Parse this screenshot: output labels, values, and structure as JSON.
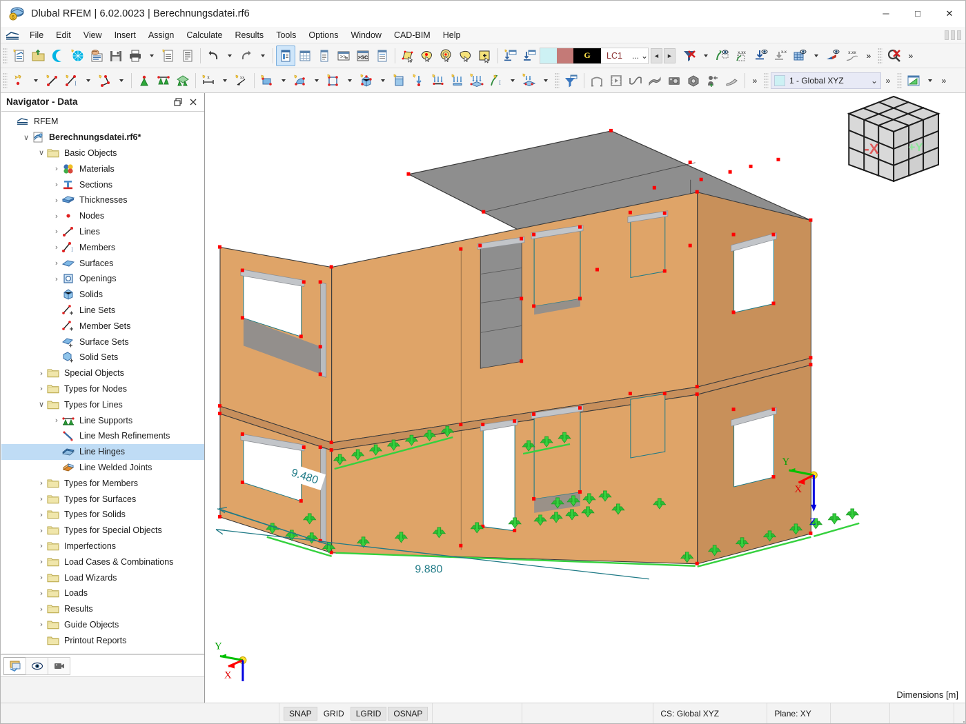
{
  "window": {
    "title": "Dlubal RFEM | 6.02.0023 | Berechnungsdatei.rf6",
    "app_icon": "rfem-app-icon",
    "minimize": "─",
    "maximize": "□",
    "close": "✕"
  },
  "menu": {
    "logo": "rfem-logo-icon",
    "items": [
      {
        "label": "File"
      },
      {
        "label": "Edit"
      },
      {
        "label": "View"
      },
      {
        "label": "Insert"
      },
      {
        "label": "Assign"
      },
      {
        "label": "Calculate"
      },
      {
        "label": "Results"
      },
      {
        "label": "Tools"
      },
      {
        "label": "Options"
      },
      {
        "label": "Window"
      },
      {
        "label": "CAD-BIM"
      },
      {
        "label": "Help"
      }
    ]
  },
  "toolbar_row1": {
    "groups": [
      {
        "icons": [
          "new-model-icon",
          "open-folder-icon",
          "dlubal-center-icon",
          "dlubal-sphere-icon",
          "model-info-icon",
          "save-icon",
          "print-icon",
          "print-caret",
          "new-report-icon",
          "report-icon"
        ]
      },
      {
        "icons": [
          "undo-icon",
          "undo-caret",
          "redo-icon",
          "redo-caret"
        ]
      },
      {
        "icons": [
          "navigator-panel-icon",
          "table-panel-icon",
          "list-panel-icon",
          "console-icon",
          "script-icon",
          "properties-panel-icon"
        ]
      },
      {
        "icons": [
          "select-polygon-icon",
          "select-lasso-icon",
          "select-circle-icon",
          "select-freehand-icon",
          "select-box-plus-icon"
        ]
      },
      {
        "icons": [
          "new-load-case-icon",
          "import-load-case-icon"
        ]
      }
    ],
    "load_case": {
      "swatch_cyan": "#cdf1f4",
      "swatch_red": "#c47a77",
      "g_label": "G",
      "lc_label": "LC1",
      "dots": "...",
      "prev": "◄",
      "next": "►"
    },
    "groups_right": [
      {
        "icons": [
          "filter-clear-icon",
          "filter-caret",
          "render-visibility-icon",
          "value-visibility-icon",
          "deformation-icon",
          "support-display-icon",
          "grid-display-icon",
          "grid-caret",
          "diagram-display-icon",
          "curve-value-icon"
        ]
      },
      {
        "icons": [
          "zoom-clear-icon"
        ]
      }
    ],
    "overflow": "»"
  },
  "toolbar_row2": {
    "groups": [
      {
        "icons": [
          "new-node-icon",
          "node-caret",
          "new-line-icon",
          "new-member-icon",
          "member-caret",
          "new-polyline-icon",
          "polyline-caret"
        ]
      },
      {
        "icons": [
          "nodal-support-icon",
          "line-support-icon",
          "surface-support-icon"
        ]
      },
      {
        "icons": [
          "dimension-x-icon",
          "dimension-caret",
          "dimension-xx-icon"
        ]
      },
      {
        "icons": [
          "new-surface-icon",
          "surface-caret",
          "new-curved-surface-icon",
          "curved-caret",
          "new-opening-icon",
          "opening-caret",
          "new-solid-icon",
          "solid-caret",
          "new-solid-set-icon"
        ]
      },
      {
        "icons": [
          "nodal-load-icon",
          "member-load-icon",
          "line-load-icon",
          "surface-load-icon",
          "free-load-icon",
          "free-load-caret",
          "imposed-load-icon",
          "imposed-caret"
        ]
      },
      {
        "icons": [
          "filter-icon",
          "section-view-icon",
          "animation-icon",
          "result-diagram-icon",
          "result-surface-icon",
          "camera-icon",
          "render-cube-icon",
          "move-view-icon",
          "clipping-icon"
        ]
      }
    ],
    "cs_selector": {
      "swatch": "#cdf1f4",
      "value": "1 - Global XYZ",
      "chevron": "∨"
    },
    "right_group": {
      "icons": [
        "chart-green-icon",
        "chart-caret"
      ]
    },
    "overflow": "»"
  },
  "navigator": {
    "title": "Navigator - Data",
    "undock_icon": "undock-icon",
    "close_icon": "close-icon",
    "tree": [
      {
        "label": "RFEM",
        "indent": 0,
        "twist": "",
        "icon": "rfem-root-icon",
        "bold": false,
        "selected": false
      },
      {
        "label": "Berechnungsdatei.rf6*",
        "indent": 1,
        "twist": "∨",
        "icon": "model-file-icon",
        "bold": true,
        "selected": false
      },
      {
        "label": "Basic Objects",
        "indent": 2,
        "twist": "∨",
        "icon": "folder-icon",
        "bold": false,
        "selected": false
      },
      {
        "label": "Materials",
        "indent": 3,
        "twist": "›",
        "icon": "materials-icon",
        "bold": false,
        "selected": false
      },
      {
        "label": "Sections",
        "indent": 3,
        "twist": "›",
        "icon": "sections-icon",
        "bold": false,
        "selected": false
      },
      {
        "label": "Thicknesses",
        "indent": 3,
        "twist": "›",
        "icon": "thicknesses-icon",
        "bold": false,
        "selected": false
      },
      {
        "label": "Nodes",
        "indent": 3,
        "twist": "›",
        "icon": "nodes-icon",
        "bold": false,
        "selected": false
      },
      {
        "label": "Lines",
        "indent": 3,
        "twist": "›",
        "icon": "lines-icon",
        "bold": false,
        "selected": false
      },
      {
        "label": "Members",
        "indent": 3,
        "twist": "›",
        "icon": "members-icon",
        "bold": false,
        "selected": false
      },
      {
        "label": "Surfaces",
        "indent": 3,
        "twist": "›",
        "icon": "surfaces-icon",
        "bold": false,
        "selected": false
      },
      {
        "label": "Openings",
        "indent": 3,
        "twist": "›",
        "icon": "openings-icon",
        "bold": false,
        "selected": false
      },
      {
        "label": "Solids",
        "indent": 3,
        "twist": "",
        "icon": "solids-icon",
        "bold": false,
        "selected": false
      },
      {
        "label": "Line Sets",
        "indent": 3,
        "twist": "",
        "icon": "line-sets-icon",
        "bold": false,
        "selected": false
      },
      {
        "label": "Member Sets",
        "indent": 3,
        "twist": "",
        "icon": "member-sets-icon",
        "bold": false,
        "selected": false
      },
      {
        "label": "Surface Sets",
        "indent": 3,
        "twist": "",
        "icon": "surface-sets-icon",
        "bold": false,
        "selected": false
      },
      {
        "label": "Solid Sets",
        "indent": 3,
        "twist": "",
        "icon": "solid-sets-icon",
        "bold": false,
        "selected": false
      },
      {
        "label": "Special Objects",
        "indent": 2,
        "twist": "›",
        "icon": "folder-icon",
        "bold": false,
        "selected": false
      },
      {
        "label": "Types for Nodes",
        "indent": 2,
        "twist": "›",
        "icon": "folder-icon",
        "bold": false,
        "selected": false
      },
      {
        "label": "Types for Lines",
        "indent": 2,
        "twist": "∨",
        "icon": "folder-icon",
        "bold": false,
        "selected": false
      },
      {
        "label": "Line Supports",
        "indent": 3,
        "twist": "›",
        "icon": "line-supports-icon",
        "bold": false,
        "selected": false
      },
      {
        "label": "Line Mesh Refinements",
        "indent": 3,
        "twist": "",
        "icon": "line-mesh-icon",
        "bold": false,
        "selected": false
      },
      {
        "label": "Line Hinges",
        "indent": 3,
        "twist": "",
        "icon": "line-hinges-icon",
        "bold": false,
        "selected": true
      },
      {
        "label": "Line Welded Joints",
        "indent": 3,
        "twist": "",
        "icon": "line-welded-icon",
        "bold": false,
        "selected": false
      },
      {
        "label": "Types for Members",
        "indent": 2,
        "twist": "›",
        "icon": "folder-icon",
        "bold": false,
        "selected": false
      },
      {
        "label": "Types for Surfaces",
        "indent": 2,
        "twist": "›",
        "icon": "folder-icon",
        "bold": false,
        "selected": false
      },
      {
        "label": "Types for Solids",
        "indent": 2,
        "twist": "›",
        "icon": "folder-icon",
        "bold": false,
        "selected": false
      },
      {
        "label": "Types for Special Objects",
        "indent": 2,
        "twist": "›",
        "icon": "folder-icon",
        "bold": false,
        "selected": false
      },
      {
        "label": "Imperfections",
        "indent": 2,
        "twist": "›",
        "icon": "folder-icon",
        "bold": false,
        "selected": false
      },
      {
        "label": "Load Cases & Combinations",
        "indent": 2,
        "twist": "›",
        "icon": "folder-icon",
        "bold": false,
        "selected": false
      },
      {
        "label": "Load Wizards",
        "indent": 2,
        "twist": "›",
        "icon": "folder-icon",
        "bold": false,
        "selected": false
      },
      {
        "label": "Loads",
        "indent": 2,
        "twist": "›",
        "icon": "folder-icon",
        "bold": false,
        "selected": false
      },
      {
        "label": "Results",
        "indent": 2,
        "twist": "›",
        "icon": "folder-icon",
        "bold": false,
        "selected": false
      },
      {
        "label": "Guide Objects",
        "indent": 2,
        "twist": "›",
        "icon": "folder-icon",
        "bold": false,
        "selected": false
      },
      {
        "label": "Printout Reports",
        "indent": 2,
        "twist": "",
        "icon": "folder-icon",
        "bold": false,
        "selected": false
      }
    ],
    "footer_buttons": [
      {
        "icon": "navigator-views-icon",
        "active": true
      },
      {
        "icon": "eye-icon",
        "active": false
      },
      {
        "icon": "camera-icon",
        "active": false
      }
    ]
  },
  "viewport": {
    "dimensions_label": "Dimensions [m]",
    "view_cube": {
      "face_x": "-X",
      "face_y": "+Y"
    },
    "axes_origin": {
      "x": "X",
      "y": "Y",
      "z": "Z"
    },
    "axes_model": {
      "x": "X",
      "y": "Y",
      "z": "Z"
    },
    "dimension_lines": [
      {
        "value": "9.480",
        "axis": "y"
      },
      {
        "value": "9.880",
        "axis": "x"
      }
    ],
    "colors": {
      "wall": "#dfa468",
      "wall_dark": "#c8905a",
      "slab": "#8c8c8c",
      "slab_light": "#a3a3a3",
      "node": "#ff0000",
      "support": "#22c22a",
      "dimension": "#1f7a86",
      "beam": "#b9bcc0"
    }
  },
  "status_bar": {
    "toggles": [
      {
        "label": "SNAP",
        "on": true
      },
      {
        "label": "GRID",
        "on": false
      },
      {
        "label": "LGRID",
        "on": true
      },
      {
        "label": "OSNAP",
        "on": true
      }
    ],
    "coordinate_system": "CS: Global XYZ",
    "plane": "Plane: XY"
  }
}
